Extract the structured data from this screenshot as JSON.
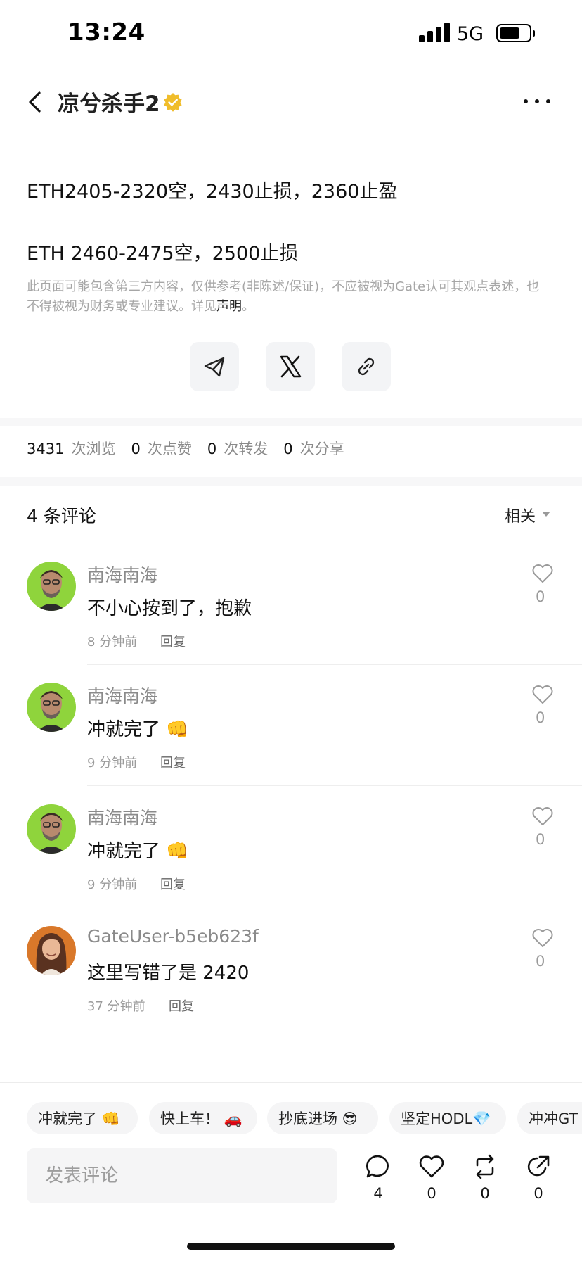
{
  "status_bar": {
    "time": "13:24",
    "network": "5G"
  },
  "header": {
    "title": "凉兮杀手2"
  },
  "post": {
    "line1": "ETH2405-2320空，2430止损，2360止盈",
    "line2": "ETH 2460-2475空，2500止损",
    "disclaimer_text": "此页面可能包含第三方内容，仅供参考(非陈述/保证)，不应被视为Gate认可其观点表述，也不得被视为财务或专业建议。详见",
    "disclaimer_link": "声明",
    "disclaimer_end": "。"
  },
  "stats": {
    "views": "3431",
    "views_label": "次浏览",
    "likes": "0",
    "likes_label": "次点赞",
    "reposts": "0",
    "reposts_label": "次转发",
    "shares": "0",
    "shares_label": "次分享"
  },
  "comments_header": {
    "title": "4 条评论",
    "sort_label": "相关"
  },
  "comments": [
    {
      "name": "南海南海",
      "text": "不小心按到了，抱歉",
      "time": "8 分钟前",
      "reply": "回复",
      "likes": "0"
    },
    {
      "name": "南海南海",
      "text": "冲就完了 👊",
      "time": "9 分钟前",
      "reply": "回复",
      "likes": "0"
    },
    {
      "name": "南海南海",
      "text": "冲就完了 👊",
      "time": "9 分钟前",
      "reply": "回复",
      "likes": "0"
    },
    {
      "name": "GateUser-b5eb623f",
      "text": "这里写错了是 2420",
      "time": "37 分钟前",
      "reply": "回复",
      "likes": "0"
    }
  ],
  "quick_replies": [
    "冲就完了 👊",
    "快上车！ 🚗",
    "抄底进场 😎",
    "坚定HODL💎",
    "冲冲GT"
  ],
  "comment_input": {
    "placeholder": "发表评论"
  },
  "actions": {
    "comments": "4",
    "likes": "0",
    "reposts": "0",
    "shares": "0"
  }
}
